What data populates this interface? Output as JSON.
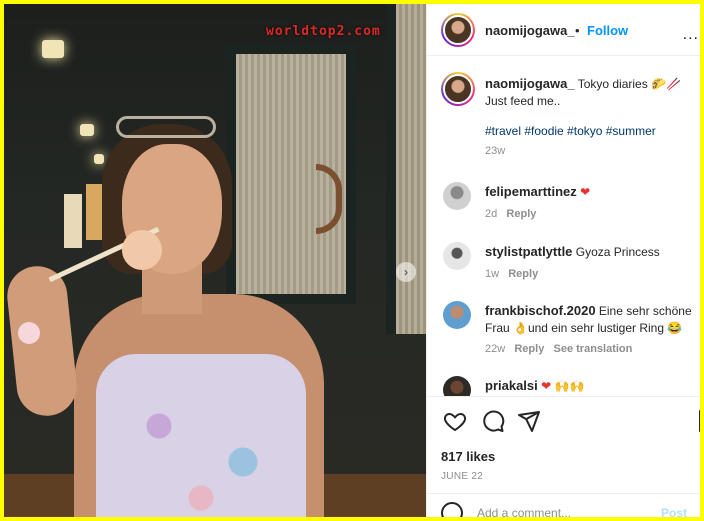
{
  "watermark": "worldtop2.com",
  "post": {
    "username": "naomijogawa_",
    "follow_label": "Follow",
    "more_label": "...",
    "caption_text": "Tokyo diaries 🌮🥢",
    "caption_line2": "Just feed me..",
    "hashtags": "#travel #foodie #tokyo #summer",
    "age": "23w"
  },
  "comments": [
    {
      "user": "felipemarttinez",
      "text": "❤",
      "time": "2d",
      "reply": "Reply",
      "translate": ""
    },
    {
      "user": "stylistpatlyttle",
      "text": "Gyoza Princess",
      "time": "1w",
      "reply": "Reply",
      "translate": ""
    },
    {
      "user": "frankbischof.2020",
      "text": "Eine sehr schöne Frau 👌und ein sehr lustiger Ring 😂",
      "time": "22w",
      "reply": "Reply",
      "translate": "See translation"
    },
    {
      "user": "priakalsi",
      "text": "❤ 🙌🙌",
      "time": "",
      "reply": "",
      "translate": ""
    }
  ],
  "actions": {
    "likes": "817 likes",
    "date": "JUNE 22",
    "comment_placeholder": "Add a comment...",
    "post_label": "Post"
  },
  "icons": [
    "heart-icon",
    "comment-icon",
    "share-icon",
    "bookmark-icon",
    "emoji-icon",
    "carousel-next-icon"
  ],
  "colors": {
    "accent": "#0095f6",
    "like_red": "#e8332f",
    "frame": "#ffff00"
  }
}
